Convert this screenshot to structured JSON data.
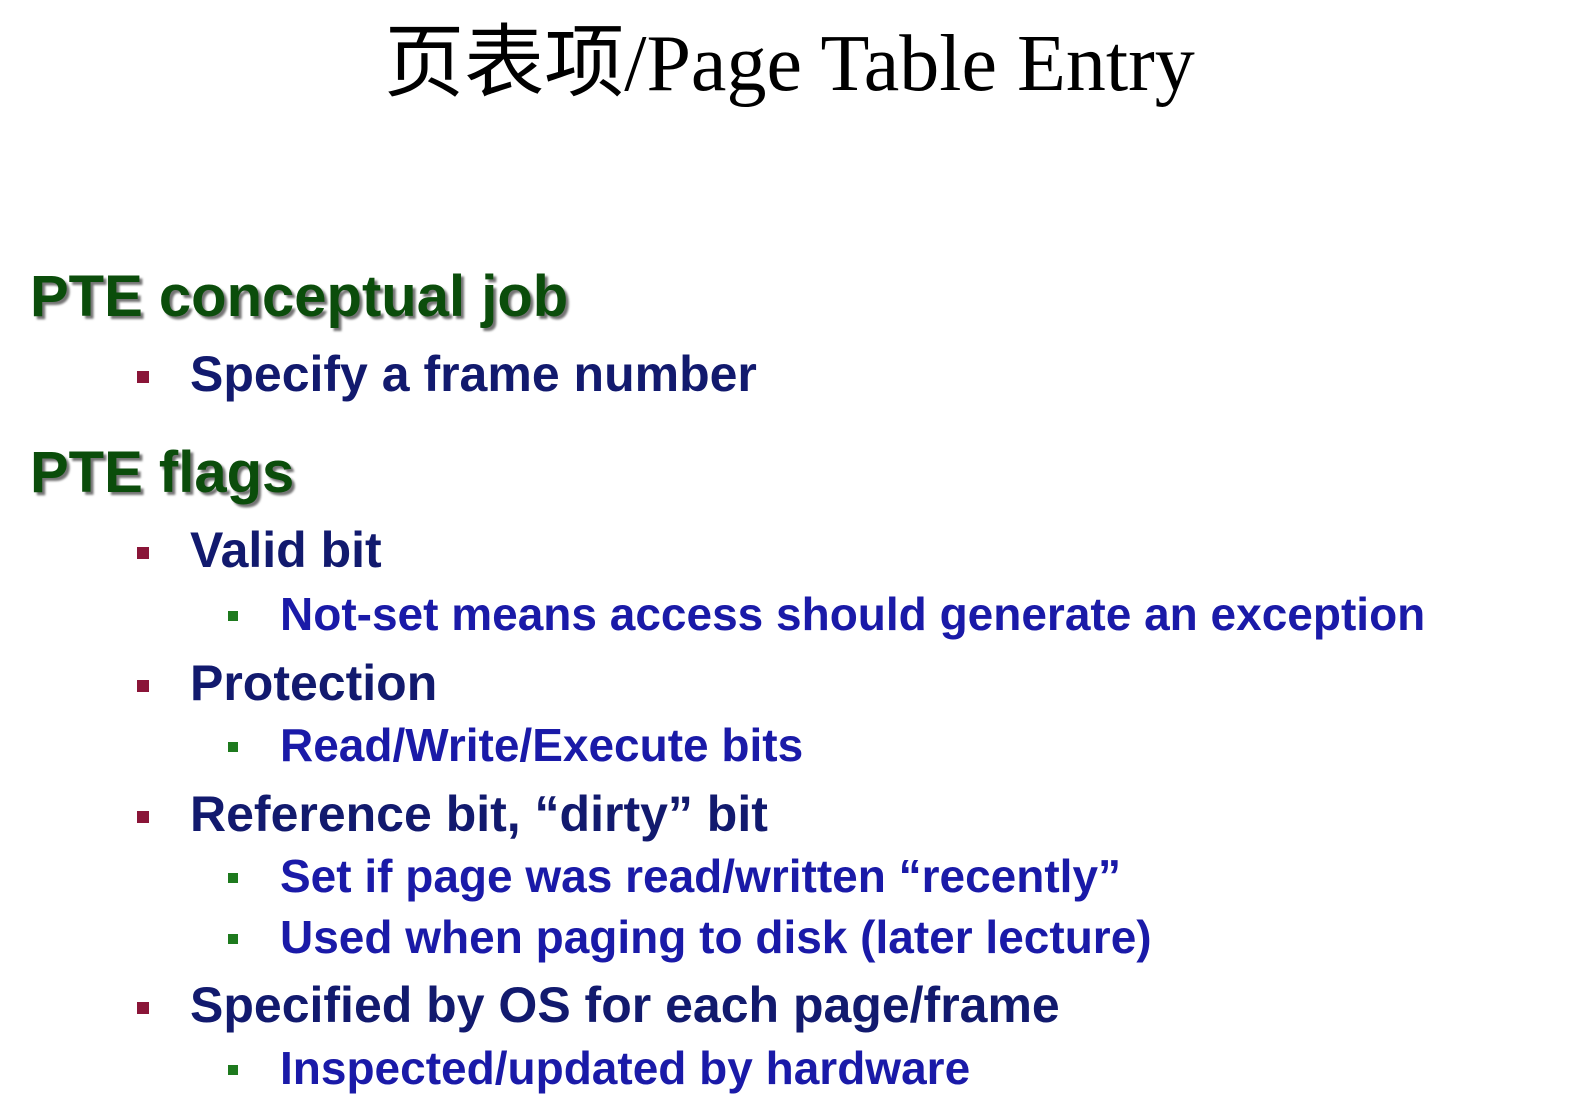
{
  "slide": {
    "title": "页表项/Page Table Entry",
    "sections": [
      {
        "heading": "PTE conceptual job",
        "items": [
          {
            "text": "Specify a frame number",
            "subitems": []
          }
        ]
      },
      {
        "heading": "PTE flags",
        "items": [
          {
            "text": "Valid bit",
            "subitems": [
              "Not-set means access should generate an exception"
            ]
          },
          {
            "text": "Protection",
            "subitems": [
              "Read/Write/Execute bits"
            ]
          },
          {
            "text": "Reference bit, “dirty” bit",
            "subitems": [
              "Set if page was read/written “recently”",
              "Used when paging to disk (later lecture)"
            ]
          },
          {
            "text": "Specified by OS for each page/frame",
            "subitems": [
              "Inspected/updated by hardware"
            ]
          }
        ]
      }
    ]
  },
  "colors": {
    "heading": "#0b4d0b",
    "level1_text": "#121a6e",
    "level2_text": "#1a1aa8",
    "level1_bullet": "#8a1538",
    "level2_bullet": "#1e7a1e"
  }
}
